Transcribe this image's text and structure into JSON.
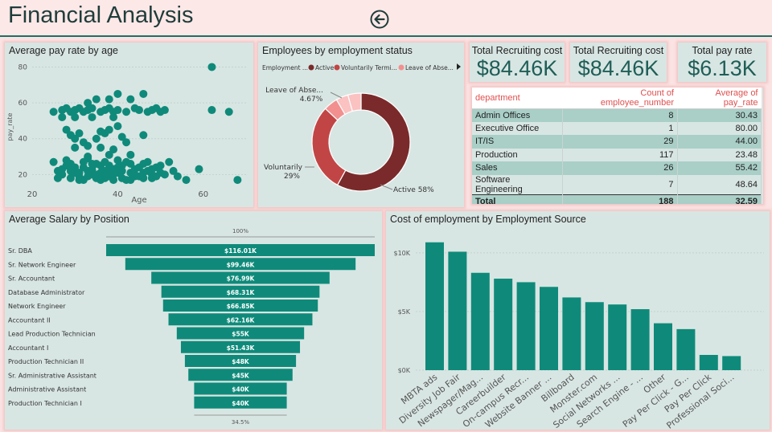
{
  "header": {
    "title": "Financial Analysis"
  },
  "colors": {
    "teal": "#0f8a7a",
    "active": "#7a2a2a",
    "voluntary": "#c24545",
    "leave": "#f29090",
    "other": "#fbc2c2"
  },
  "panels": {
    "scatter_title": "Average pay rate by age",
    "donut_title": "Employees by employment status",
    "funnel_title": "Average Salary by Position",
    "bar_title": "Cost of employment  by Employment Source"
  },
  "cards": [
    {
      "title": "Total Recruiting cost",
      "value": "$84.46K"
    },
    {
      "title": "Total Recruiting cost",
      "value": "$84.46K"
    },
    {
      "title": "Total pay rate",
      "value": "$6.13K"
    }
  ],
  "table": {
    "headers": [
      "department",
      "Count of employee_number",
      "Average of pay_rate"
    ],
    "rows": [
      [
        "Admin Offices",
        "8",
        "30.43"
      ],
      [
        "Executive Office",
        "1",
        "80.00"
      ],
      [
        "IT/IS",
        "29",
        "44.00"
      ],
      [
        "Production",
        "117",
        "23.48"
      ],
      [
        "Sales",
        "26",
        "55.42"
      ],
      [
        "Software Engineering",
        "7",
        "48.64"
      ]
    ],
    "total": [
      "Total",
      "188",
      "32.59"
    ]
  },
  "chart_data": [
    {
      "type": "scatter",
      "title": "Average pay rate by age",
      "xlabel": "Age",
      "ylabel": "pay_rate",
      "xlim": [
        20,
        70
      ],
      "ylim": [
        13,
        82
      ],
      "xticks": [
        20,
        40,
        60
      ],
      "yticks": [
        20,
        40,
        60,
        80
      ],
      "points": [
        [
          25,
          55
        ],
        [
          27,
          56
        ],
        [
          28,
          57
        ],
        [
          29,
          55
        ],
        [
          30,
          56
        ],
        [
          31,
          57
        ],
        [
          32,
          55
        ],
        [
          33,
          56
        ],
        [
          34,
          57
        ],
        [
          36,
          55
        ],
        [
          37,
          56
        ],
        [
          38,
          57
        ],
        [
          39,
          55
        ],
        [
          40,
          56
        ],
        [
          42,
          55
        ],
        [
          44,
          57
        ],
        [
          45,
          56
        ],
        [
          47,
          55
        ],
        [
          48,
          56
        ],
        [
          49,
          57
        ],
        [
          50,
          55
        ],
        [
          51,
          56
        ],
        [
          27,
          52
        ],
        [
          30,
          52
        ],
        [
          34,
          52
        ],
        [
          35,
          62
        ],
        [
          38,
          62
        ],
        [
          40,
          65
        ],
        [
          43,
          62
        ],
        [
          46,
          65
        ],
        [
          33,
          60
        ],
        [
          39,
          52
        ],
        [
          62,
          80
        ],
        [
          62,
          56
        ],
        [
          66,
          55
        ],
        [
          28,
          45
        ],
        [
          29,
          42
        ],
        [
          30,
          40
        ],
        [
          31,
          43
        ],
        [
          32,
          38
        ],
        [
          33,
          36
        ],
        [
          36,
          44
        ],
        [
          38,
          45
        ],
        [
          40,
          47
        ],
        [
          35,
          40
        ],
        [
          37,
          43
        ],
        [
          41,
          41
        ],
        [
          42,
          38
        ],
        [
          46,
          42
        ],
        [
          30,
          35
        ],
        [
          25,
          27
        ],
        [
          26,
          22
        ],
        [
          27,
          20
        ],
        [
          28,
          25
        ],
        [
          29,
          18
        ],
        [
          30,
          24
        ],
        [
          31,
          21
        ],
        [
          32,
          27
        ],
        [
          33,
          19
        ],
        [
          34,
          23
        ],
        [
          35,
          26
        ],
        [
          36,
          17
        ],
        [
          37,
          22
        ],
        [
          38,
          25
        ],
        [
          39,
          20
        ],
        [
          40,
          24
        ],
        [
          41,
          18
        ],
        [
          42,
          27
        ],
        [
          43,
          21
        ],
        [
          44,
          23
        ],
        [
          45,
          19
        ],
        [
          46,
          26
        ],
        [
          47,
          22
        ],
        [
          48,
          18
        ],
        [
          49,
          24
        ],
        [
          50,
          25
        ],
        [
          51,
          20
        ],
        [
          52,
          27
        ],
        [
          53,
          22
        ],
        [
          54,
          19
        ],
        [
          56,
          17
        ],
        [
          59,
          23
        ],
        [
          68,
          17
        ],
        [
          26,
          18
        ],
        [
          27,
          23
        ],
        [
          28,
          28
        ],
        [
          29,
          26
        ],
        [
          30,
          21
        ],
        [
          31,
          17
        ],
        [
          32,
          24
        ],
        [
          33,
          29
        ],
        [
          34,
          20
        ],
        [
          35,
          18
        ],
        [
          36,
          25
        ],
        [
          37,
          27
        ],
        [
          38,
          19
        ],
        [
          39,
          23
        ],
        [
          40,
          28
        ],
        [
          41,
          22
        ],
        [
          42,
          17
        ],
        [
          43,
          26
        ],
        [
          44,
          20
        ],
        [
          45,
          24
        ],
        [
          46,
          18
        ],
        [
          47,
          27
        ],
        [
          48,
          23
        ],
        [
          49,
          19
        ],
        [
          50,
          21
        ],
        [
          29,
          22
        ],
        [
          31,
          19
        ],
        [
          32,
          17
        ],
        [
          33,
          22
        ],
        [
          34,
          26
        ],
        [
          35,
          20
        ],
        [
          36,
          21
        ],
        [
          37,
          18
        ],
        [
          38,
          22
        ],
        [
          39,
          17
        ],
        [
          40,
          21
        ],
        [
          41,
          25
        ],
        [
          43,
          17
        ],
        [
          44,
          19
        ],
        [
          46,
          21
        ],
        [
          48,
          20
        ],
        [
          33,
          30
        ],
        [
          38,
          31
        ],
        [
          43,
          31
        ],
        [
          36,
          35
        ],
        [
          39,
          34
        ]
      ]
    },
    {
      "type": "pie",
      "title": "Employees by employment status",
      "legend_title": "Employment ...",
      "legend": [
        "Active",
        "Voluntarily Termi...",
        "Leave of Abse..."
      ],
      "slices": [
        {
          "name": "Active",
          "value": 58,
          "label": "Active 58%"
        },
        {
          "name": "Voluntarily",
          "value": 29,
          "label": "Voluntarily",
          "label2": "29%"
        },
        {
          "name": "Leave of Abse...",
          "value": 4.67,
          "label": "Leave of Abse...",
          "label2": "4.67%"
        },
        {
          "name": "Other",
          "value": 4.0
        },
        {
          "name": "Other2",
          "value": 4.33
        }
      ]
    },
    {
      "type": "bar",
      "title": "Average Salary by Position",
      "top_label": "100%",
      "bottom_label": "34.5%",
      "categories": [
        "Sr. DBA",
        "Sr. Network Engineer",
        "Sr. Accountant",
        "Database Administrator",
        "Network Engineer",
        "Accountant II",
        "Lead Production Technician",
        "Accountant I",
        "Production Technician II",
        "Sr. Administrative Assistant",
        "Administrative Assistant",
        "Production Technician I"
      ],
      "values": [
        116.01,
        99.46,
        76.99,
        68.31,
        66.85,
        62.16,
        55,
        51.43,
        48,
        45,
        40,
        40
      ],
      "labels": [
        "$116.01K",
        "$99.46K",
        "$76.99K",
        "$68.31K",
        "$66.85K",
        "$62.16K",
        "$55K",
        "$51.43K",
        "$48K",
        "$45K",
        "$40K",
        "$40K"
      ]
    },
    {
      "type": "bar",
      "title": "Cost of employment  by Employment Source",
      "ylim": [
        0,
        11500
      ],
      "yticks": [
        0,
        5000,
        10000
      ],
      "ytick_labels": [
        "$0K",
        "$5K",
        "$10K"
      ],
      "categories": [
        "MBTA ads",
        "Diversity Job Fair",
        "Newspager/Mag...",
        "Careerbuilder",
        "On-campus Recr...",
        "Website Banner ...",
        "Billboard",
        "Monster.com",
        "Social Networks ...",
        "Search Engine - ...",
        "Other",
        "Pay Per Click - G...",
        "Pay Per Click",
        "Professional Soci..."
      ],
      "values": [
        10900,
        10100,
        8300,
        7800,
        7500,
        7100,
        6200,
        5800,
        5600,
        5200,
        4000,
        3500,
        1300,
        1200
      ]
    }
  ]
}
